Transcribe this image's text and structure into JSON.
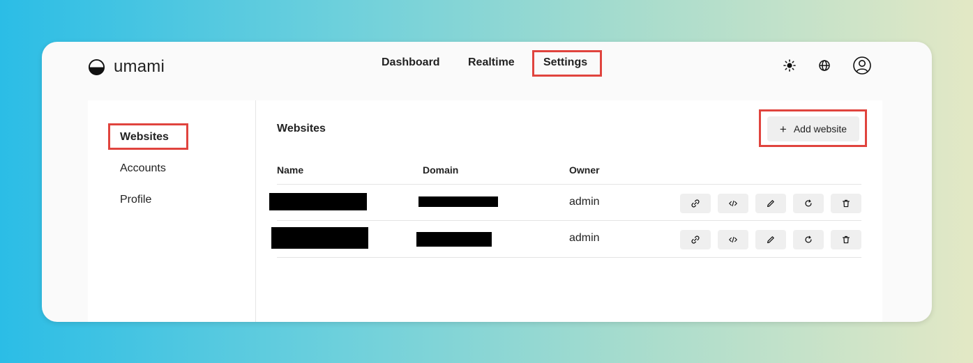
{
  "app": {
    "name": "umami"
  },
  "nav": {
    "items": [
      "Dashboard",
      "Realtime",
      "Settings"
    ],
    "active": "Settings"
  },
  "header_icons": [
    "sun-icon",
    "globe-icon",
    "user-profile-icon"
  ],
  "sidebar": {
    "items": [
      "Websites",
      "Accounts",
      "Profile"
    ],
    "active": "Websites"
  },
  "main": {
    "title": "Websites",
    "add_button": "Add website",
    "columns": [
      "Name",
      "Domain",
      "Owner"
    ],
    "rows": [
      {
        "name": "",
        "domain": "",
        "owner": "admin"
      },
      {
        "name": "",
        "domain": "",
        "owner": "admin"
      }
    ],
    "row_actions": [
      "link-icon",
      "code-icon",
      "edit-icon",
      "reset-icon",
      "delete-icon"
    ]
  },
  "colors": {
    "highlight": "#e0443e",
    "button_bg": "#efefef"
  }
}
